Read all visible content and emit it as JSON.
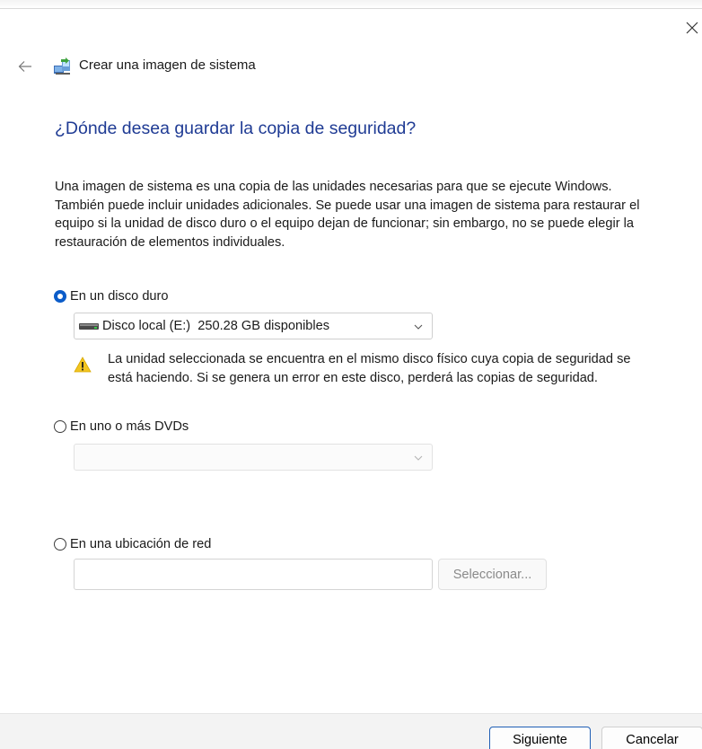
{
  "window": {
    "title": "Crear una imagen de sistema",
    "app_icon": "backup-drive-icon",
    "back_icon": "arrow-left-icon",
    "close_icon": "close-icon"
  },
  "page": {
    "heading": "¿Dónde desea guardar la copia de seguridad?",
    "description": "Una imagen de sistema es una copia de las unidades necesarias para que se ejecute Windows. También puede incluir unidades adicionales. Se puede usar una imagen de sistema para restaurar el equipo si la unidad de disco duro o el equipo dejan de funcionar; sin embargo, no se puede elegir la restauración de elementos individuales."
  },
  "options": {
    "hard_disk": {
      "label": "En un disco duro",
      "selected": true,
      "dropdown_value": "Disco local (E:)  250.28 GB disponibles",
      "dropdown_icon": "hard-drive-icon",
      "warning_icon": "warning-icon",
      "warning": "La unidad seleccionada se encuentra en el mismo disco físico cuya copia de seguridad se está haciendo. Si se genera un error en este disco, perderá las copias de seguridad."
    },
    "dvd": {
      "label": "En uno o más DVDs",
      "selected": false,
      "dropdown_value": ""
    },
    "network": {
      "label": "En una ubicación de red",
      "selected": false,
      "input_value": "",
      "select_button": "Seleccionar..."
    }
  },
  "footer": {
    "next_button": "Siguiente",
    "cancel_button": "Cancelar"
  },
  "colors": {
    "heading": "#1f3b94",
    "accent": "#0b5cc9",
    "footer_bg": "#f3f3f3",
    "warning": "#f2c521"
  }
}
